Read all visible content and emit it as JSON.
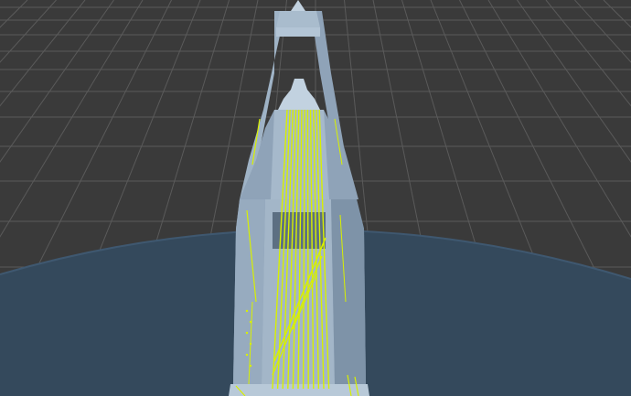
{
  "viewport": {
    "background": "#3a3a3a",
    "grid_color": "#5a5a5a",
    "ground_color": "#34495c",
    "ground_edge_color": "#3f5870",
    "structure_color": "#9fb3c6",
    "structure_shade": "#7e93a8",
    "structure_highlight": "#c2d2e0",
    "wire_color": "#d8f000",
    "grid_visible": true
  }
}
